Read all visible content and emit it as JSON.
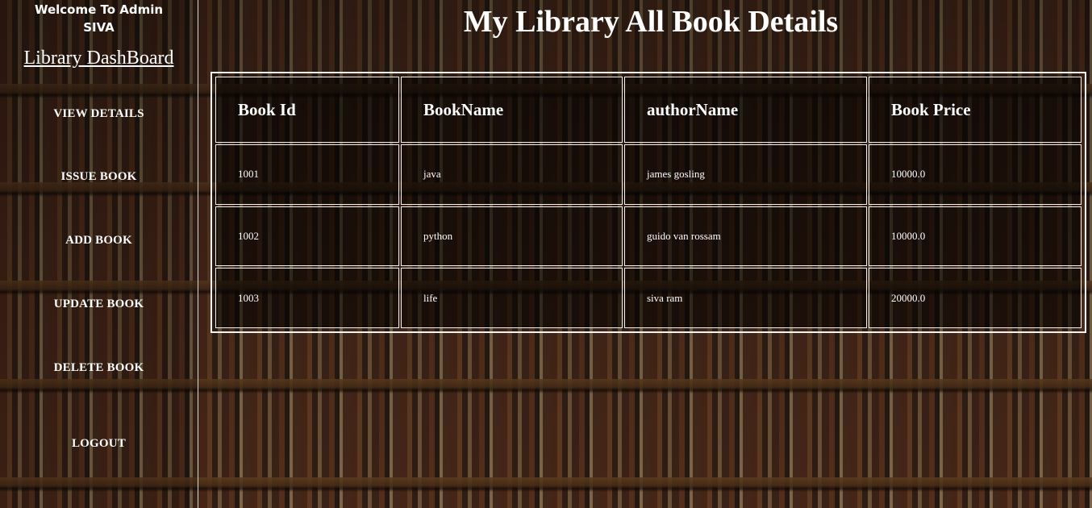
{
  "sidebar": {
    "welcome_line1": "Welcome To Admin",
    "welcome_line2": "SIVA",
    "dashboard_title": "Library DashBoard",
    "nav": [
      {
        "label": "VIEW DETAILS"
      },
      {
        "label": "ISSUE BOOK"
      },
      {
        "label": "ADD BOOK"
      },
      {
        "label": "UPDATE BOOK"
      },
      {
        "label": "DELETE BOOK"
      },
      {
        "label": "LOGOUT"
      }
    ]
  },
  "main": {
    "title": "My Library All Book Details",
    "table": {
      "headers": [
        "Book Id",
        "BookName",
        "authorName",
        "Book Price"
      ],
      "rows": [
        [
          "1001",
          "java",
          "james gosling",
          "10000.0"
        ],
        [
          "1002",
          "python",
          "guido van rossam",
          "10000.0"
        ],
        [
          "1003",
          "life",
          "siva ram",
          "20000.0"
        ]
      ]
    }
  },
  "colors": {
    "text": "#ffffff",
    "border": "#f2f2f2"
  }
}
